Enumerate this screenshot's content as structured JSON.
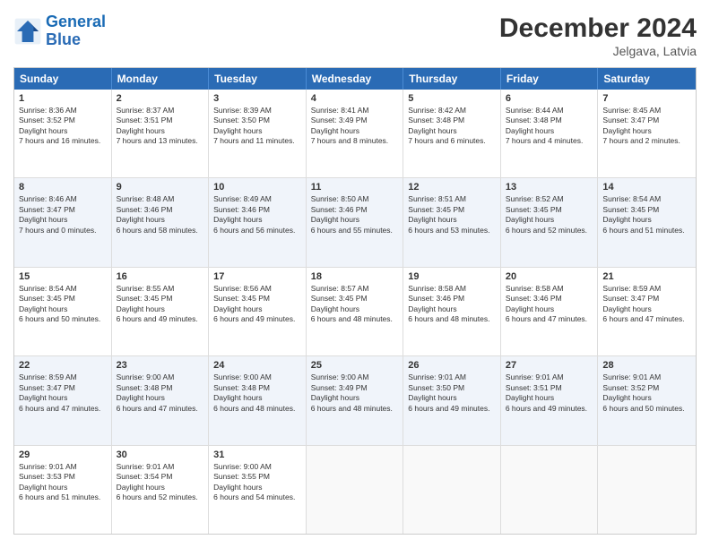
{
  "logo": {
    "line1": "General",
    "line2": "Blue"
  },
  "title": "December 2024",
  "subtitle": "Jelgava, Latvia",
  "days": [
    "Sunday",
    "Monday",
    "Tuesday",
    "Wednesday",
    "Thursday",
    "Friday",
    "Saturday"
  ],
  "weeks": [
    [
      {
        "day": "1",
        "rise": "8:36 AM",
        "set": "3:52 PM",
        "daylight": "7 hours and 16 minutes."
      },
      {
        "day": "2",
        "rise": "8:37 AM",
        "set": "3:51 PM",
        "daylight": "7 hours and 13 minutes."
      },
      {
        "day": "3",
        "rise": "8:39 AM",
        "set": "3:50 PM",
        "daylight": "7 hours and 11 minutes."
      },
      {
        "day": "4",
        "rise": "8:41 AM",
        "set": "3:49 PM",
        "daylight": "7 hours and 8 minutes."
      },
      {
        "day": "5",
        "rise": "8:42 AM",
        "set": "3:48 PM",
        "daylight": "7 hours and 6 minutes."
      },
      {
        "day": "6",
        "rise": "8:44 AM",
        "set": "3:48 PM",
        "daylight": "7 hours and 4 minutes."
      },
      {
        "day": "7",
        "rise": "8:45 AM",
        "set": "3:47 PM",
        "daylight": "7 hours and 2 minutes."
      }
    ],
    [
      {
        "day": "8",
        "rise": "8:46 AM",
        "set": "3:47 PM",
        "daylight": "7 hours and 0 minutes."
      },
      {
        "day": "9",
        "rise": "8:48 AM",
        "set": "3:46 PM",
        "daylight": "6 hours and 58 minutes."
      },
      {
        "day": "10",
        "rise": "8:49 AM",
        "set": "3:46 PM",
        "daylight": "6 hours and 56 minutes."
      },
      {
        "day": "11",
        "rise": "8:50 AM",
        "set": "3:46 PM",
        "daylight": "6 hours and 55 minutes."
      },
      {
        "day": "12",
        "rise": "8:51 AM",
        "set": "3:45 PM",
        "daylight": "6 hours and 53 minutes."
      },
      {
        "day": "13",
        "rise": "8:52 AM",
        "set": "3:45 PM",
        "daylight": "6 hours and 52 minutes."
      },
      {
        "day": "14",
        "rise": "8:54 AM",
        "set": "3:45 PM",
        "daylight": "6 hours and 51 minutes."
      }
    ],
    [
      {
        "day": "15",
        "rise": "8:54 AM",
        "set": "3:45 PM",
        "daylight": "6 hours and 50 minutes."
      },
      {
        "day": "16",
        "rise": "8:55 AM",
        "set": "3:45 PM",
        "daylight": "6 hours and 49 minutes."
      },
      {
        "day": "17",
        "rise": "8:56 AM",
        "set": "3:45 PM",
        "daylight": "6 hours and 49 minutes."
      },
      {
        "day": "18",
        "rise": "8:57 AM",
        "set": "3:45 PM",
        "daylight": "6 hours and 48 minutes."
      },
      {
        "day": "19",
        "rise": "8:58 AM",
        "set": "3:46 PM",
        "daylight": "6 hours and 48 minutes."
      },
      {
        "day": "20",
        "rise": "8:58 AM",
        "set": "3:46 PM",
        "daylight": "6 hours and 47 minutes."
      },
      {
        "day": "21",
        "rise": "8:59 AM",
        "set": "3:47 PM",
        "daylight": "6 hours and 47 minutes."
      }
    ],
    [
      {
        "day": "22",
        "rise": "8:59 AM",
        "set": "3:47 PM",
        "daylight": "6 hours and 47 minutes."
      },
      {
        "day": "23",
        "rise": "9:00 AM",
        "set": "3:48 PM",
        "daylight": "6 hours and 47 minutes."
      },
      {
        "day": "24",
        "rise": "9:00 AM",
        "set": "3:48 PM",
        "daylight": "6 hours and 48 minutes."
      },
      {
        "day": "25",
        "rise": "9:00 AM",
        "set": "3:49 PM",
        "daylight": "6 hours and 48 minutes."
      },
      {
        "day": "26",
        "rise": "9:01 AM",
        "set": "3:50 PM",
        "daylight": "6 hours and 49 minutes."
      },
      {
        "day": "27",
        "rise": "9:01 AM",
        "set": "3:51 PM",
        "daylight": "6 hours and 49 minutes."
      },
      {
        "day": "28",
        "rise": "9:01 AM",
        "set": "3:52 PM",
        "daylight": "6 hours and 50 minutes."
      }
    ],
    [
      {
        "day": "29",
        "rise": "9:01 AM",
        "set": "3:53 PM",
        "daylight": "6 hours and 51 minutes."
      },
      {
        "day": "30",
        "rise": "9:01 AM",
        "set": "3:54 PM",
        "daylight": "6 hours and 52 minutes."
      },
      {
        "day": "31",
        "rise": "9:00 AM",
        "set": "3:55 PM",
        "daylight": "6 hours and 54 minutes."
      },
      null,
      null,
      null,
      null
    ]
  ]
}
